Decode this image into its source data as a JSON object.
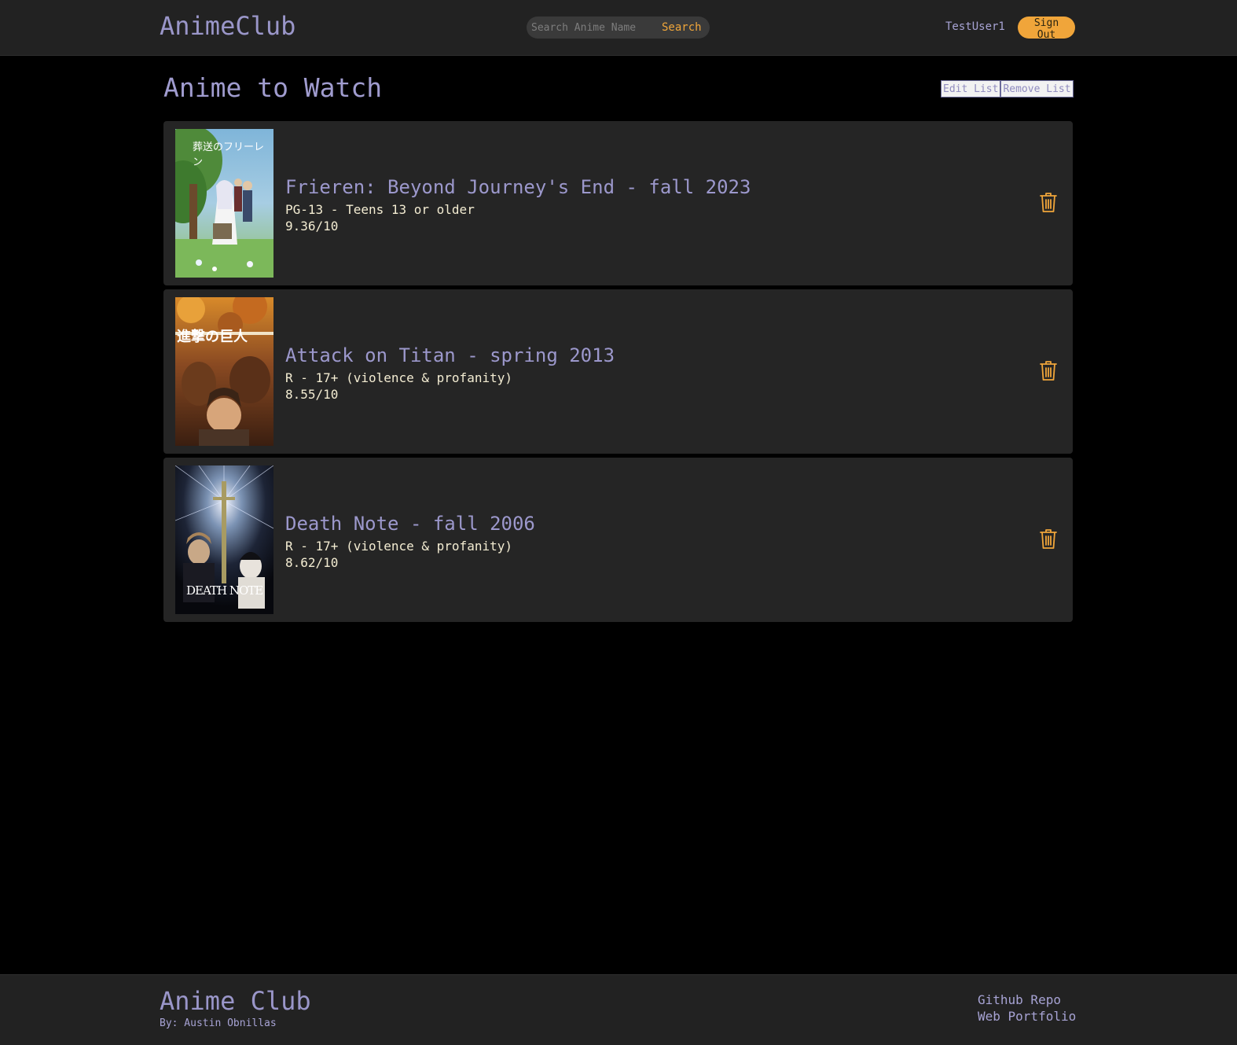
{
  "header": {
    "brand": "AnimeClub",
    "search_placeholder": "Search Anime Name",
    "search_label": "Search",
    "username": "TestUser1",
    "signout_label": "Sign Out"
  },
  "main": {
    "title": "Anime to Watch",
    "edit_label": "Edit List",
    "remove_label": "Remove List",
    "items": [
      {
        "title": "Frieren: Beyond Journey's End - fall 2023",
        "rating": "PG-13 - Teens 13 or older",
        "score": "9.36/10",
        "poster_text": "葬送のフリーレン"
      },
      {
        "title": "Attack on Titan - spring 2013",
        "rating": "R - 17+ (violence & profanity)",
        "score": "8.55/10",
        "poster_text": "進撃の巨人"
      },
      {
        "title": "Death Note - fall 2006",
        "rating": "R - 17+ (violence & profanity)",
        "score": "8.62/10",
        "poster_text": "DEATH NOTE"
      }
    ]
  },
  "footer": {
    "title": "Anime Club",
    "byline": "By: Austin Obnillas",
    "link_github": "Github Repo",
    "link_portfolio": "Web Portfolio"
  },
  "colors": {
    "accent_purple": "#9a96c9",
    "accent_orange": "#f0a53a",
    "card_bg": "#252525",
    "bar_bg": "#222222"
  }
}
